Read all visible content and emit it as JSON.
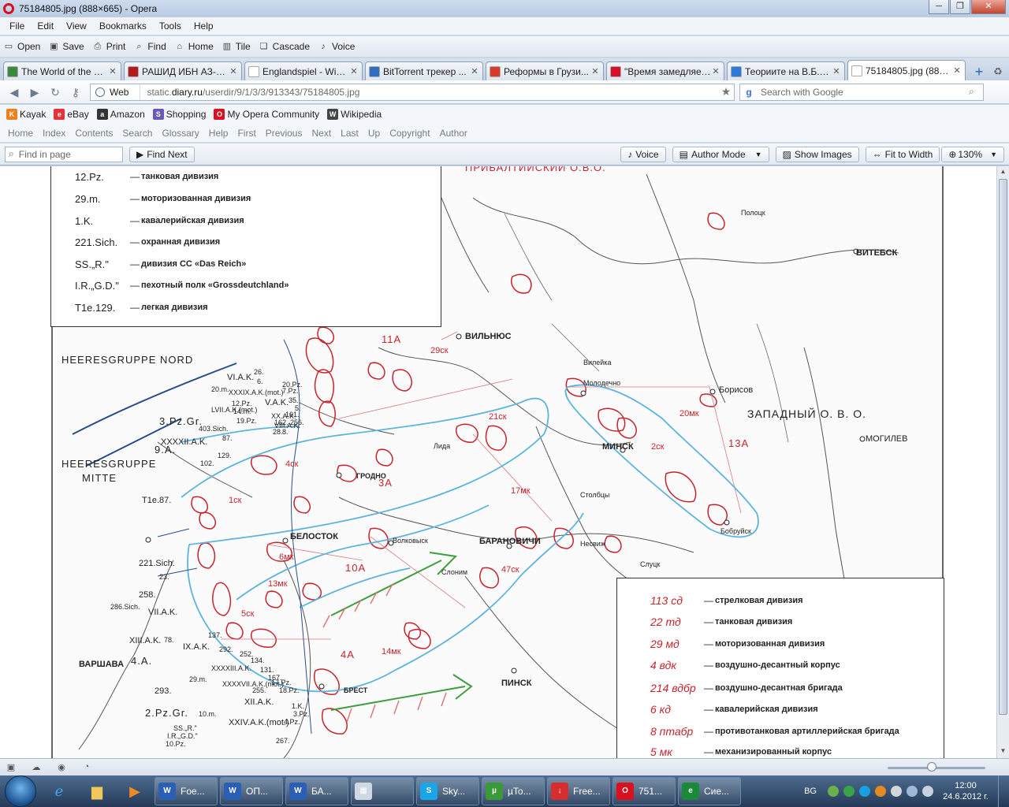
{
  "window": {
    "title": "75184805.jpg (888×665) - Opera",
    "controls": {
      "minimize": "─",
      "maximize": "❐",
      "close": "✕"
    }
  },
  "menu": [
    "File",
    "Edit",
    "View",
    "Bookmarks",
    "Tools",
    "Help"
  ],
  "toolbar": [
    {
      "label": "Open",
      "icon": "folder-icon"
    },
    {
      "label": "Save",
      "icon": "save-icon"
    },
    {
      "label": "Print",
      "icon": "print-icon"
    },
    {
      "label": "Find",
      "icon": "find-icon"
    },
    {
      "label": "Home",
      "icon": "home-icon"
    },
    {
      "label": "Tile",
      "icon": "tile-icon"
    },
    {
      "label": "Cascade",
      "icon": "cascade-icon"
    },
    {
      "label": "Voice",
      "icon": "voice-icon"
    }
  ],
  "tabs": [
    {
      "label": "The World of the H...",
      "color": "#3b8a3e",
      "glyph": "g"
    },
    {
      "label": "РАШИД ИБН АЗ-З...",
      "color": "#b31b1b",
      "glyph": "L"
    },
    {
      "label": "Englandspiel - Wiki...",
      "color": "#ffffff",
      "glyph": ""
    },
    {
      "label": "BitTorrent трекер ...",
      "color": "#2f6fc1",
      "glyph": ""
    },
    {
      "label": "Реформы в Грузи...",
      "color": "#d83a2a",
      "glyph": ""
    },
    {
      "label": "\"Время замедляет...",
      "color": "#d8102a",
      "glyph": ""
    },
    {
      "label": "Теориите на В.Б.Р...",
      "color": "#2f7ad8",
      "glyph": ""
    },
    {
      "label": "75184805.jpg (888...",
      "color": "#ffffff",
      "glyph": ""
    }
  ],
  "address": {
    "web_label": "Web",
    "url_prefix": "static.",
    "url_domain": "diary.ru",
    "url_path": "/userdir/9/1/3/3/913343/75184805.jpg",
    "search_placeholder": "Search with Google"
  },
  "bookmarks": [
    {
      "label": "Kayak",
      "color": "#f07f1e",
      "glyph": "K"
    },
    {
      "label": "eBay",
      "color": "#e53238",
      "glyph": "e"
    },
    {
      "label": "Amazon",
      "color": "#333333",
      "glyph": "a"
    },
    {
      "label": "Shopping",
      "color": "#6b59b7",
      "glyph": "S"
    },
    {
      "label": "My Opera Community",
      "color": "#d9101f",
      "glyph": "O"
    },
    {
      "label": "Wikipedia",
      "color": "#444444",
      "glyph": "W"
    }
  ],
  "navlinks": [
    "Home",
    "Index",
    "Contents",
    "Search",
    "Glossary",
    "Help",
    "First",
    "Previous",
    "Next",
    "Last",
    "Up",
    "Copyright",
    "Author"
  ],
  "findbar": {
    "placeholder": "Find in page",
    "find_next": "Find Next",
    "voice": "Voice",
    "author_mode": "Author Mode",
    "show_images": "Show Images",
    "fit_to_width": "Fit to Width",
    "zoom": "130%"
  },
  "legend_top": [
    {
      "code": "12.Pz.",
      "desc": "танковая дивизия"
    },
    {
      "code": "29.m.",
      "desc": "моторизованная дивизия"
    },
    {
      "code": "1.K.",
      "desc": "кавалерийская дивизия"
    },
    {
      "code": "221.Sich.",
      "desc": "охранная дивизия"
    },
    {
      "code": "SS.„R.\"",
      "desc": "дивизия СС «Das Reich»"
    },
    {
      "code": "I.R.„G.D.\"",
      "desc": "пехотный полк «Grossdeutchland»"
    },
    {
      "code": "T1e.129.",
      "desc": "легкая дивизия"
    }
  ],
  "legend_bottom": [
    {
      "code": "113 сд",
      "desc": "стрелковая дивизия"
    },
    {
      "code": "22 тд",
      "desc": "танковая дивизия"
    },
    {
      "code": "29 мд",
      "desc": "моторизованная дивизия"
    },
    {
      "code": "4 вдк",
      "desc": "воздушно-десантный корпус"
    },
    {
      "code": "214 вдбр",
      "desc": "воздушно-десантная бригада"
    },
    {
      "code": "6 кд",
      "desc": "кавалерийская дивизия"
    },
    {
      "code": "8 птабр",
      "desc": "противотанковая артиллерийская бригада"
    },
    {
      "code": "5 мк",
      "desc": "механизированный корпус"
    }
  ],
  "map_labels": {
    "heeres_nord": "HEERESGRUPPE  NORD",
    "heeres_mitte_1": "HEERESGRUPPE",
    "heeres_mitte_2": "MITTE",
    "zapadny": "ЗАПАДНЫЙ  О. В. О.",
    "pribalt": "ПРИБАЛТИЙСКИЙ  О.В.О.",
    "vilnius": "ВИЛЬНЮС",
    "minsk": "МИНСК",
    "belostok": "БЕЛОСТОК",
    "grodno": "ГРОДНО",
    "baranovichi": "БАРАНОВИЧИ",
    "brest": "БРЕСТ",
    "varshava": "ВАРШАВА",
    "vitebsk": "ВИТЕБСК",
    "mogilev": "МОГИЛЕВ",
    "pinsk": "ПИНСК",
    "borisov": "Борисов",
    "bobruysk": "Бобруйск",
    "slutsk": "Слуцк",
    "nesvizh": "Несвиж",
    "stolbtsy": "Столбцы",
    "lida": "Лида",
    "volkovysk": "Волковыск",
    "slonim": "Слоним",
    "vileyka": "Вилейка",
    "molodechno": "Молодечно",
    "polotsk": "Полоцк",
    "army_11a": "11А",
    "army_3a": "3А",
    "army_10a": "10А",
    "army_4a": "4А",
    "army_13a": "13А",
    "corps_29sk": "29ск",
    "corps_21sk": "21ск",
    "corps_17mk": "17мк",
    "corps_20mk": "20мк",
    "corps_47sk": "47ск",
    "corps_14mk": "14мк",
    "corps_13mk": "13мк",
    "corps_6mk": "6мк",
    "corps_5sk": "5ск",
    "corps_1sk": "1ск",
    "corps_4sk": "4ск",
    "corps_2sk": "2ск",
    "pzgr3": "3.Pz.Gr.",
    "pzgr2": "2.Pz.Gr.",
    "army9a": "9.A.",
    "army4a_de": "4.A.",
    "viak": "VI.A.K.",
    "vak": "V.A.K.",
    "viiak": "VII.A.K.",
    "xiiiak": "XIII.A.K.",
    "ixak": "IX.A.K.",
    "xiiak": "XII.A.K.",
    "xxivak": "XXIV.A.K.(mot.)",
    "xxxxviiak": "XXXXVII.A.K.(mot.)",
    "xxxxiiak": "XXXXII.A.K.",
    "xxxixak": "XXXIX.A.K.(mot.)",
    "lviiak": "LVII.A.K.(mot.)",
    "xxak": "XX.A.K.",
    "viiiak": "VIII.A.K.",
    "xxxxiiiak": "XXXXIII.A.K.",
    "sich221": "221.Sich.",
    "tle87": "T1e.87.",
    "div258": "258.",
    "div286": "286.Sich.",
    "div293": "293.",
    "div10pz": "10.Pz.",
    "div4pz": "4.Pz.",
    "div3pz": "3.Pz.",
    "div17pz": "17.Pz.",
    "div18pz": "18.Pz.",
    "div29m": "29.m.",
    "div10m": "10.m.",
    "div131": "131.",
    "div134": "134.",
    "div252": "252.",
    "div137": "137.",
    "div292": "292.",
    "div78": "78.",
    "div23": "23.",
    "div102": "102.",
    "div129": "129.",
    "div87": "87.",
    "div403": "403.Sich.",
    "div20m": "20.m.",
    "div7pz": "7.Pz.",
    "div19pz": "19.Pz.",
    "div12pz": "12.Pz.",
    "div14m": "14.m.",
    "div20pz": "20.Pz.",
    "div35": "35.",
    "div5": "5.",
    "div26": "26.",
    "div6": "6.",
    "div162": "162.",
    "div256": "256.",
    "div161": "161.",
    "div28": "28.",
    "div8": "8.",
    "div167": "167.",
    "div1k": "1.K.",
    "div267": "267.",
    "div255": "255.",
    "ssr": "SS.„R.\"",
    "irgd": "I.R.„G.D.\""
  },
  "statusbar": {
    "icons": [
      "panel-icon",
      "cloud-icon",
      "speed-dial-icon",
      "turbo-icon"
    ]
  },
  "taskbar": {
    "tasks": [
      {
        "label": "Foe...",
        "color": "#2a5fb5",
        "glyph": "W"
      },
      {
        "label": "ОП...",
        "color": "#2a5fb5",
        "glyph": "W"
      },
      {
        "label": "БА...",
        "color": "#2a5fb5",
        "glyph": "W"
      },
      {
        "label": "",
        "color": "#cfd8e3",
        "glyph": "▦"
      },
      {
        "label": "Sky...",
        "color": "#1ca4e8",
        "glyph": "S"
      },
      {
        "label": "µTo...",
        "color": "#3a9a3a",
        "glyph": "µ"
      },
      {
        "label": "Free...",
        "color": "#d62d2d",
        "glyph": "↓"
      },
      {
        "label": "751...",
        "color": "#d9101f",
        "glyph": "O"
      },
      {
        "label": "Сие...",
        "color": "#1a8a3a",
        "glyph": "e"
      }
    ],
    "lang": "BG",
    "time": "12:00",
    "date": "24.6.2012 г."
  }
}
